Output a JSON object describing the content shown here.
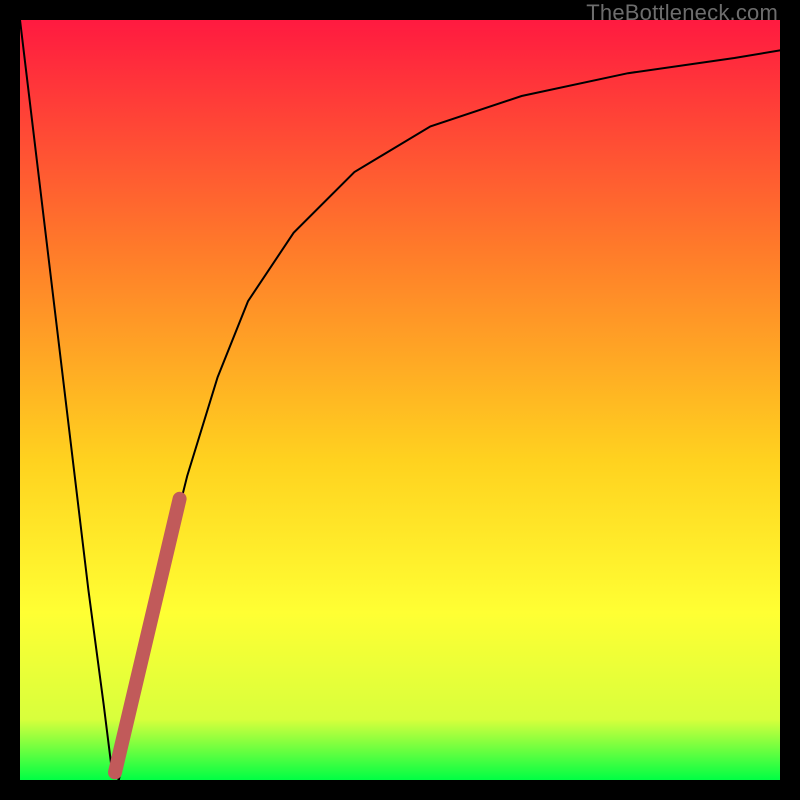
{
  "watermark": {
    "text": "TheBottleneck.com"
  },
  "colors": {
    "gradient_top": "#ff1a40",
    "gradient_mid_upper": "#ff7a2a",
    "gradient_mid": "#ffd21f",
    "gradient_mid_lower": "#ffff33",
    "gradient_lower": "#d8ff3c",
    "gradient_bottom": "#00ff44",
    "curve": "#000000",
    "accent_segment": "#c15a5a",
    "background": "#000000"
  },
  "chart_data": {
    "type": "line",
    "title": "",
    "xlabel": "",
    "ylabel": "",
    "xlim": [
      0,
      100
    ],
    "ylim": [
      0,
      100
    ],
    "series": [
      {
        "name": "bottleneck-curve",
        "x": [
          0,
          6,
          9,
          11,
          12,
          13,
          15,
          18,
          22,
          26,
          30,
          36,
          44,
          54,
          66,
          80,
          94,
          100
        ],
        "values": [
          100,
          50,
          25,
          10,
          2,
          0,
          9,
          24,
          40,
          53,
          63,
          72,
          80,
          86,
          90,
          93,
          95,
          96
        ]
      }
    ],
    "accent_segment": {
      "name": "highlighted-range",
      "x_start": 12.5,
      "y_start": 1,
      "x_end": 21,
      "y_end": 37
    },
    "minimum_point": {
      "x": 13,
      "y": 0
    }
  }
}
